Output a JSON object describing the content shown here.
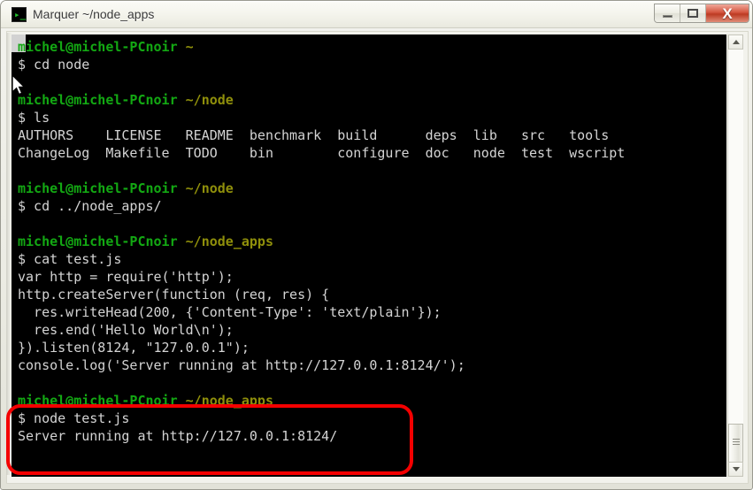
{
  "window": {
    "title": "Marquer ~/node_apps",
    "app_icon": "terminal-icon",
    "controls": {
      "minimize_label": "Minimize",
      "maximize_label": "Maximize",
      "close_label": "X"
    }
  },
  "terminal": {
    "user_host": "michel@michel-PCnoir",
    "prompt_symbol": "$",
    "colors": {
      "background": "#000000",
      "user_host": "#13a813",
      "path": "#8f8f0b",
      "text": "#d4d4d4",
      "annotation": "#f40000"
    },
    "lines": [
      {
        "type": "prompt",
        "user_host": "michel@michel-PCnoir",
        "path": "~"
      },
      {
        "type": "command",
        "text": "$ cd node"
      },
      {
        "type": "blank",
        "text": ""
      },
      {
        "type": "prompt",
        "user_host": "michel@michel-PCnoir",
        "path": "~/node"
      },
      {
        "type": "command",
        "text": "$ ls"
      },
      {
        "type": "output",
        "text": "AUTHORS    LICENSE   README  benchmark  build      deps  lib   src   tools"
      },
      {
        "type": "output",
        "text": "ChangeLog  Makefile  TODO    bin        configure  doc   node  test  wscript"
      },
      {
        "type": "blank",
        "text": ""
      },
      {
        "type": "prompt",
        "user_host": "michel@michel-PCnoir",
        "path": "~/node"
      },
      {
        "type": "command",
        "text": "$ cd ../node_apps/"
      },
      {
        "type": "blank",
        "text": ""
      },
      {
        "type": "prompt",
        "user_host": "michel@michel-PCnoir",
        "path": "~/node_apps"
      },
      {
        "type": "command",
        "text": "$ cat test.js"
      },
      {
        "type": "output",
        "text": "var http = require('http');"
      },
      {
        "type": "output",
        "text": "http.createServer(function (req, res) {"
      },
      {
        "type": "output",
        "text": "  res.writeHead(200, {'Content-Type': 'text/plain'});"
      },
      {
        "type": "output",
        "text": "  res.end('Hello World\\n');"
      },
      {
        "type": "output",
        "text": "}).listen(8124, \"127.0.0.1\");"
      },
      {
        "type": "output",
        "text": "console.log('Server running at http://127.0.0.1:8124/');"
      },
      {
        "type": "blank",
        "text": ""
      },
      {
        "type": "prompt",
        "user_host": "michel@michel-PCnoir",
        "path": "~/node_apps"
      },
      {
        "type": "command",
        "text": "$ node test.js"
      },
      {
        "type": "output",
        "text": "Server running at http://127.0.0.1:8124/"
      }
    ]
  },
  "scrollbar": {
    "up_arrow": "scroll-up",
    "down_arrow": "scroll-down",
    "thumb": "scroll-thumb"
  },
  "annotation": {
    "shape": "rounded-rectangle",
    "color": "#f40000",
    "highlights": "node test.js command and server running output"
  }
}
